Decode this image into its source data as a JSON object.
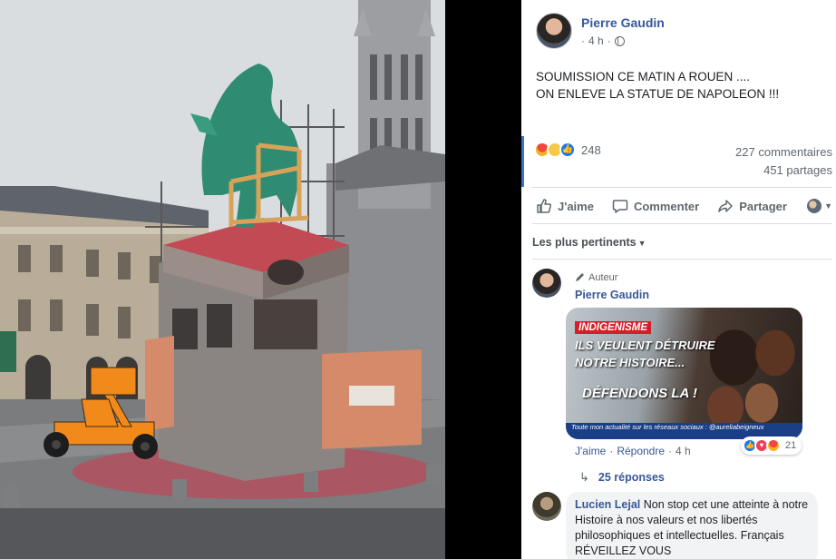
{
  "post": {
    "author": "Pierre Gaudin",
    "time": "4 h",
    "text_lines": [
      "SOUMISSION CE MATIN A ROUEN ....",
      "ON ENLEVE LA STATUE DE NAPOLEON !!!"
    ],
    "reactions_count": "248",
    "comments_count": "227 commentaires",
    "shares_count": "451 partages"
  },
  "actions": {
    "like": "J'aime",
    "comment": "Commenter",
    "share": "Partager"
  },
  "sort_label": "Les plus pertinents",
  "comments": [
    {
      "author": "Pierre Gaudin",
      "badge": "Auteur",
      "image_text": {
        "tag": "INDIGENISME",
        "line1": "ILS VEULENT DÉTRUIRE",
        "line2": "NOTRE HISTOIRE...",
        "line3": "DÉFENDONS LA !",
        "banner": "Toute mon actualité sur les réseaux sociaux : @aureliabeigneux"
      },
      "like_label": "J'aime",
      "reply_label": "Répondre",
      "time": "4 h",
      "reaction_count": "21",
      "replies_label": "25 réponses"
    },
    {
      "author": "Lucien Lejal",
      "text": "Non stop cet une atteinte à notre Histoire à nos valeurs et nos libertés philosophiques et intellectuelles. Français RÉVEILLEZ VOUS"
    }
  ],
  "colors": {
    "link_blue": "#385898",
    "like_blue": "#1877f2",
    "meta_gray": "#606770"
  }
}
